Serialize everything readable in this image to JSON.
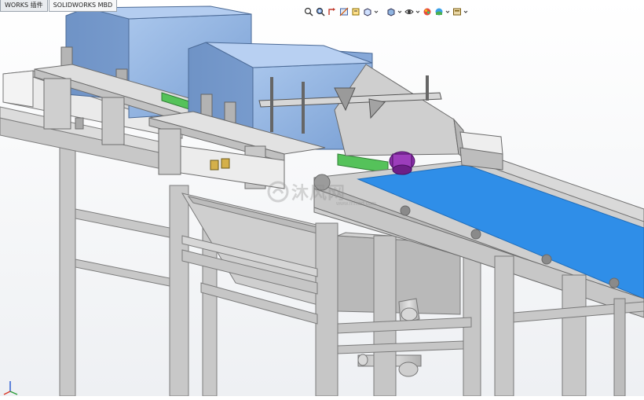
{
  "app": {
    "tabs": [
      {
        "label": "WORKS 插件"
      },
      {
        "label": "SOLIDWORKS MBD"
      }
    ]
  },
  "headsup_toolbar": {
    "icons": [
      "zoom-to-fit-icon",
      "zoom-area-icon",
      "previous-view-icon",
      "section-view-icon",
      "dynamic-annotation-icon",
      "view-orientation-icon",
      "display-style-icon",
      "hide-show-items-icon",
      "edit-appearance-icon",
      "apply-scene-icon",
      "view-settings-icon"
    ]
  },
  "watermark": {
    "text": "沐风网",
    "url": "www.mfcad.com"
  },
  "colors": {
    "housing_blue": "#8fb4e0",
    "belt_blue": "#2f8ee8",
    "frame_gray": "#c9c9c9",
    "roller_purple": "#8a2fa8",
    "axis_x": "#d93b2b",
    "axis_y": "#2a9d3a",
    "axis_z": "#2f5ed1"
  }
}
